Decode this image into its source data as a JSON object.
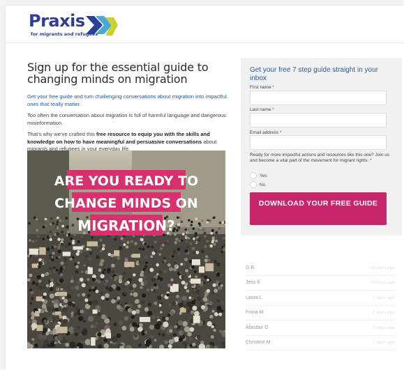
{
  "brand": {
    "name": "Praxis",
    "tagline": "for migrants and refugees",
    "primary_color": "#2e3f92",
    "accent_colors": [
      "#2a3f96",
      "#3fa3d8",
      "#c9d22f"
    ]
  },
  "intro": {
    "title": "Sign up for the essential guide to changing minds on migration",
    "lead": "Get your free guide and turn challenging conversations about migration into impactful ones that really matter.",
    "para1": "Too often the conversation about migration is full of harmful language and dangerous misinformation.",
    "para2_start": "That’s why we’ve crafted this ",
    "para2_bold": "free resource to equip you with the skills and knowledge on how to have meaningful and persuasive conversations",
    "para2_end": " about migrants and refugees in your everyday life."
  },
  "hero_image": {
    "line1": "ARE YOU READY TO",
    "line2": "CHANGE MINDS ON",
    "line3": "MIGRATION?",
    "banner_color": "#d8306b"
  },
  "form": {
    "title": "Get your free 7 step guide straight in your inbox",
    "first_name_label": "First name",
    "last_name_label": "Last name",
    "email_label": "Email address",
    "required_mark": "*",
    "question": "Ready for more impactful actions and resources like this one? Join us and become a vital part of the movement for migrant rights.",
    "options": [
      "Yes",
      "No"
    ],
    "submit_label": "DOWNLOAD YOUR FREE GUIDE",
    "submit_color": "#c8266a"
  },
  "recent_signups": [
    {
      "name": "G B",
      "time": "18 days ago"
    },
    {
      "name": "Jess K",
      "time": "19 days ago"
    },
    {
      "name": "Laura L",
      "time": "2 days ago"
    },
    {
      "name": "Fiona M",
      "time": "2 days ago"
    },
    {
      "name": "Alasdair G",
      "time": "2 days ago"
    },
    {
      "name": "Christine M",
      "time": "2 days ago"
    }
  ]
}
